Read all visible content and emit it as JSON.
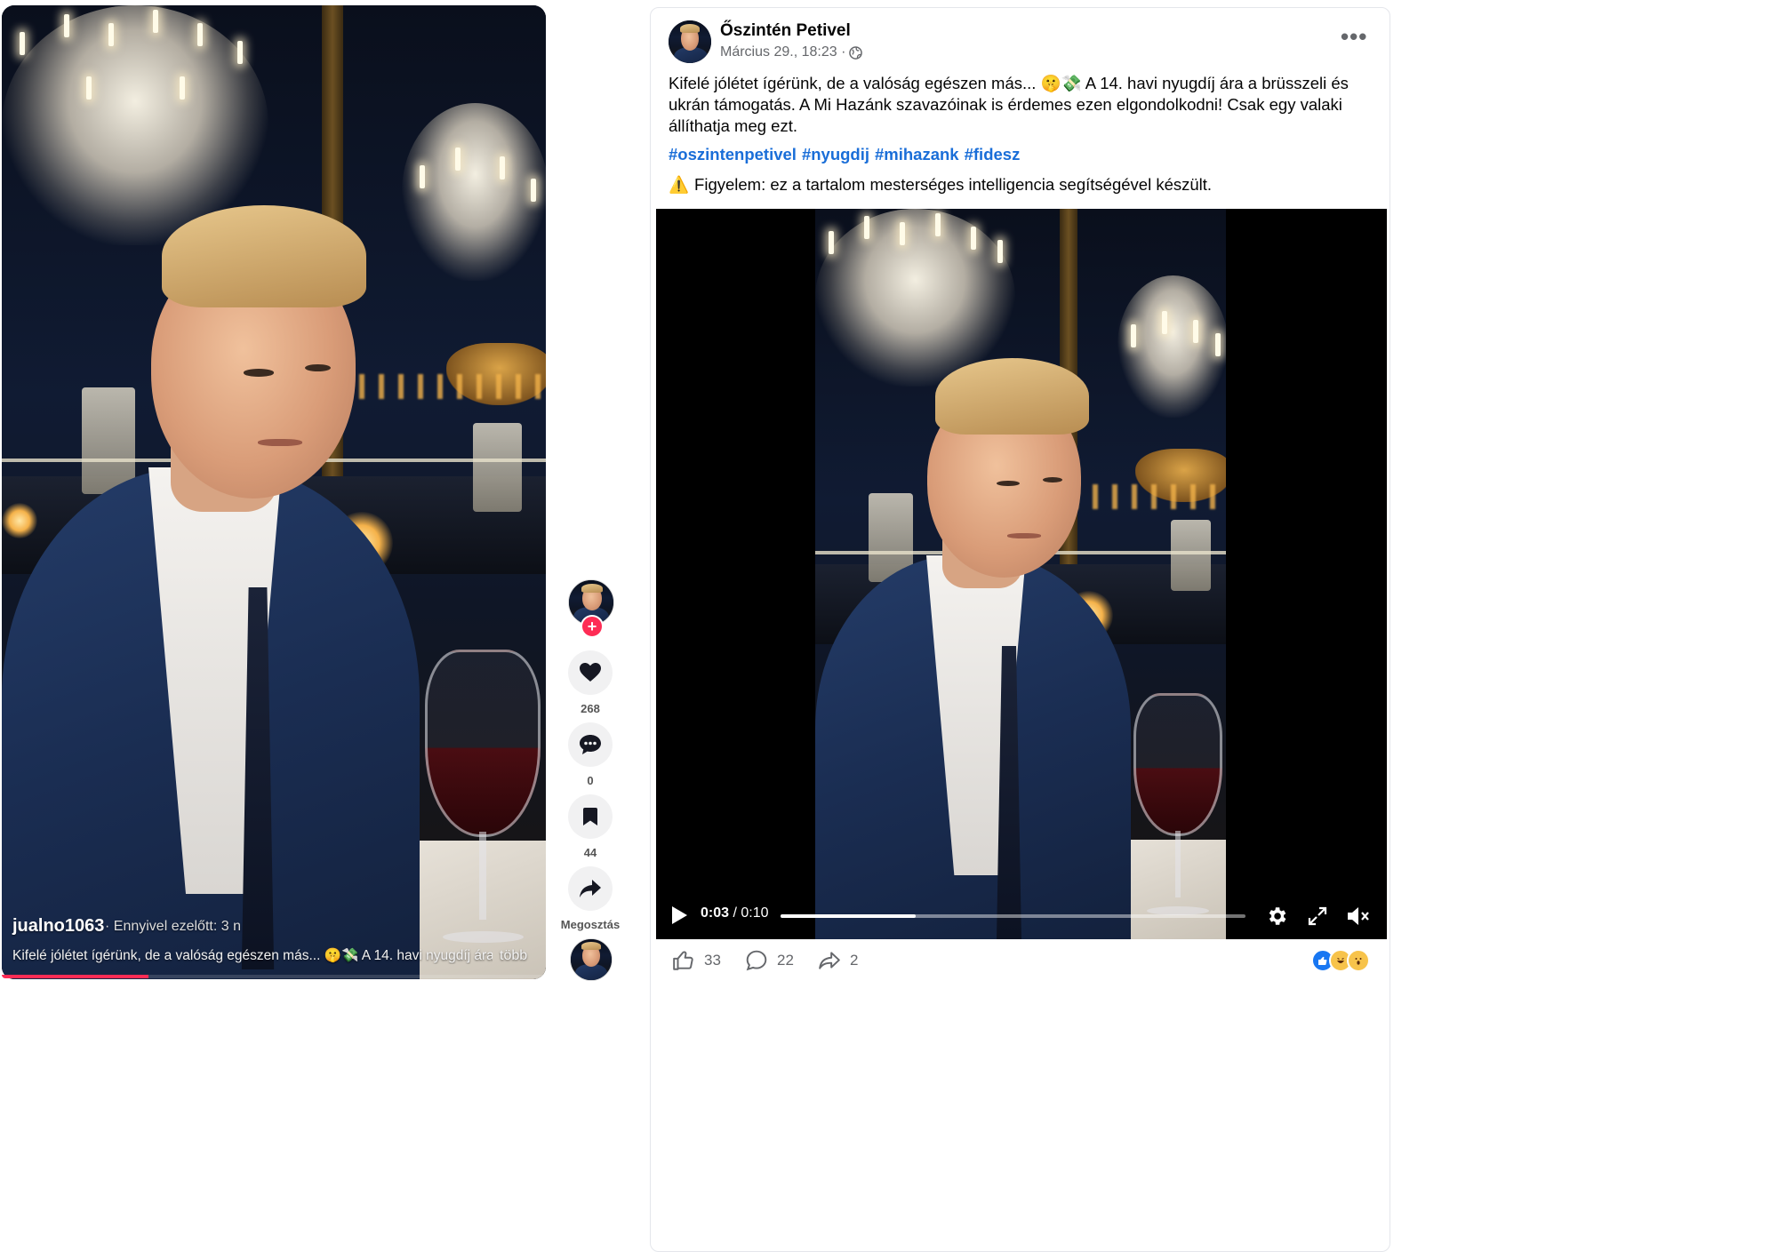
{
  "tiktok": {
    "username": "jualno1063",
    "time_ago": "· Ennyivel ezelőtt: 3 n",
    "caption": "Kifelé jólétet ígérünk, de a valóság egészen más... 🤫💸 A 14. havi nyugdíj ára a",
    "more_label": "több",
    "likes": "268",
    "comments": "0",
    "saves": "44",
    "share_label": "Megosztás",
    "follow_symbol": "+",
    "progress_fraction": 0.27,
    "accent_color": "#fe2c55",
    "icons": [
      "heart-icon",
      "comment-icon",
      "bookmark-icon",
      "share-icon"
    ]
  },
  "facebook": {
    "page_name": "Őszintén Petivel",
    "timestamp": "Március 29., 18:23 ·",
    "more_icon": "•••",
    "post_text": "Kifelé jólétet ígérünk, de a valóság egészen más... 🤫💸 A 14. havi nyugdíj ára a brüsszeli és ukrán támogatás. A Mi Hazánk szavazóinak is érdemes ezen elgondolkodni! Csak egy valaki állíthatja meg ezt.",
    "hashtags": [
      "#oszintenpetivel",
      "#nyugdij",
      "#mihazank",
      "#fidesz"
    ],
    "warning_icon": "⚠️",
    "warning_text": "Figyelem: ez a tartalom mesterséges intelligencia segítségével készült.",
    "video": {
      "current_time": "0:03",
      "separator": " / ",
      "duration": "0:10",
      "progress_fraction": 0.29
    },
    "likes": "33",
    "comments": "22",
    "shares": "2",
    "link_color": "#1a6ed8",
    "reaction_icons": [
      "like-reaction-icon",
      "haha-reaction-icon",
      "wow-reaction-icon"
    ]
  }
}
